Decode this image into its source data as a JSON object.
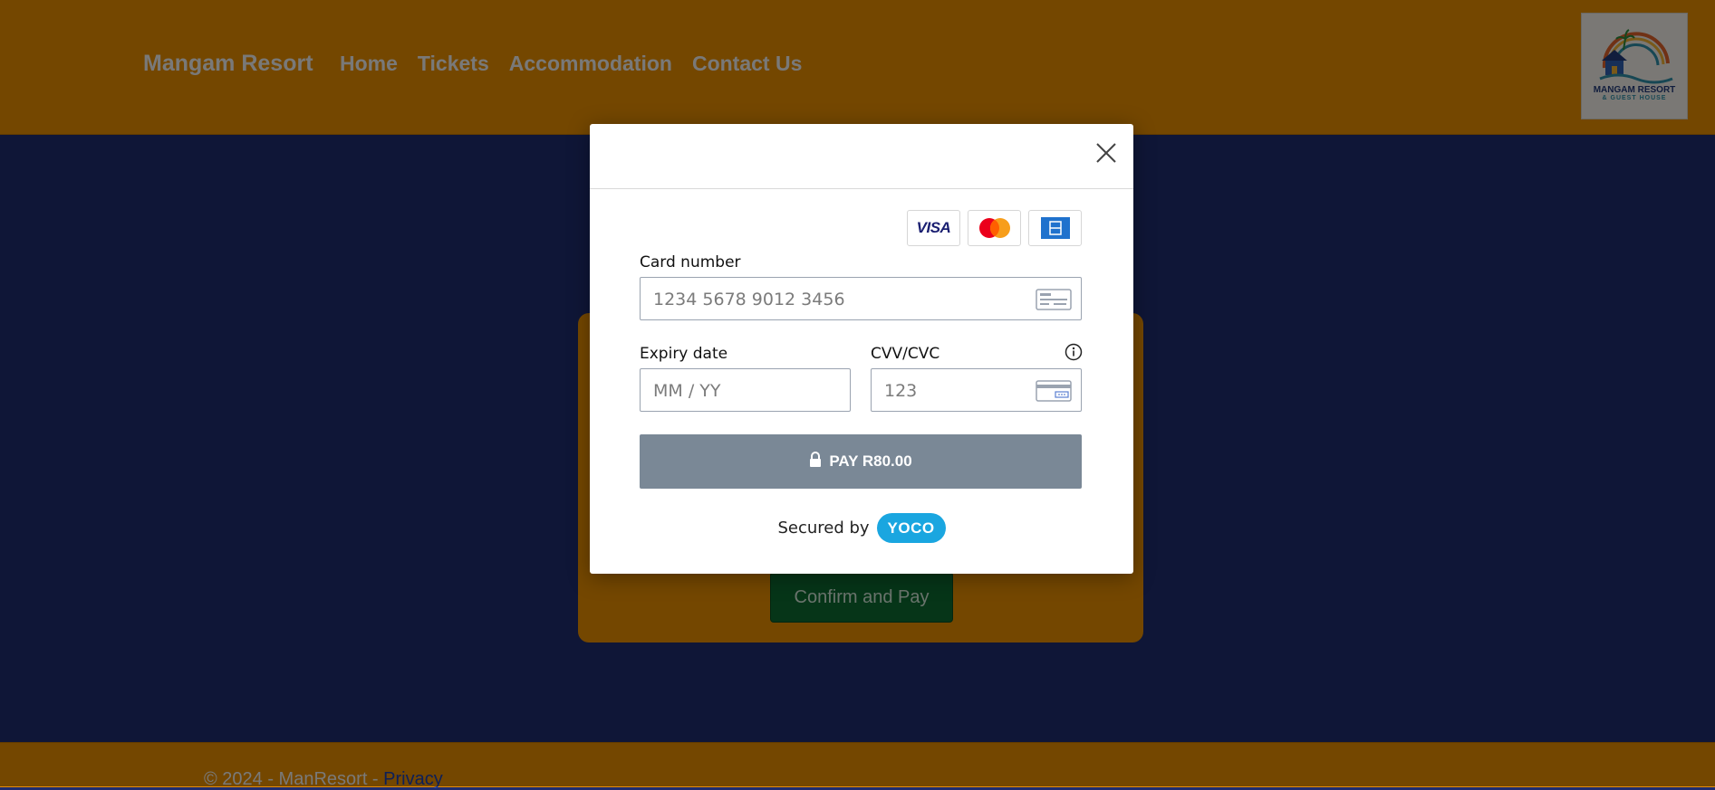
{
  "header": {
    "brand": "Mangam Resort",
    "nav": [
      "Home",
      "Tickets",
      "Accommodation",
      "Contact Us"
    ],
    "logo_text": "MANGAM RESORT",
    "logo_subtext": "& GUEST HOUSE"
  },
  "main": {
    "confirm_button": "Confirm and Pay"
  },
  "footer": {
    "copyright": "© 2024 - ManResort - ",
    "privacy_link": "Privacy"
  },
  "modal": {
    "card_brands": [
      "visa-icon",
      "mastercard-icon",
      "amex-icon"
    ],
    "visa_text": "VISA",
    "card_number_label": "Card number",
    "card_number_placeholder": "1234 5678 9012 3456",
    "expiry_label": "Expiry date",
    "expiry_placeholder": "MM / YY",
    "cvv_label": "CVV/CVC",
    "cvv_placeholder": "123",
    "pay_button": "PAY R80.00",
    "secured_by": "Secured by",
    "yoco": "YOCO"
  },
  "colors": {
    "header_bg": "#e88f00",
    "body_bg": "#1f2c6e",
    "pay_button": "#7a8896",
    "confirm_button": "#0d6b30",
    "yoco": "#1aa6e0"
  }
}
